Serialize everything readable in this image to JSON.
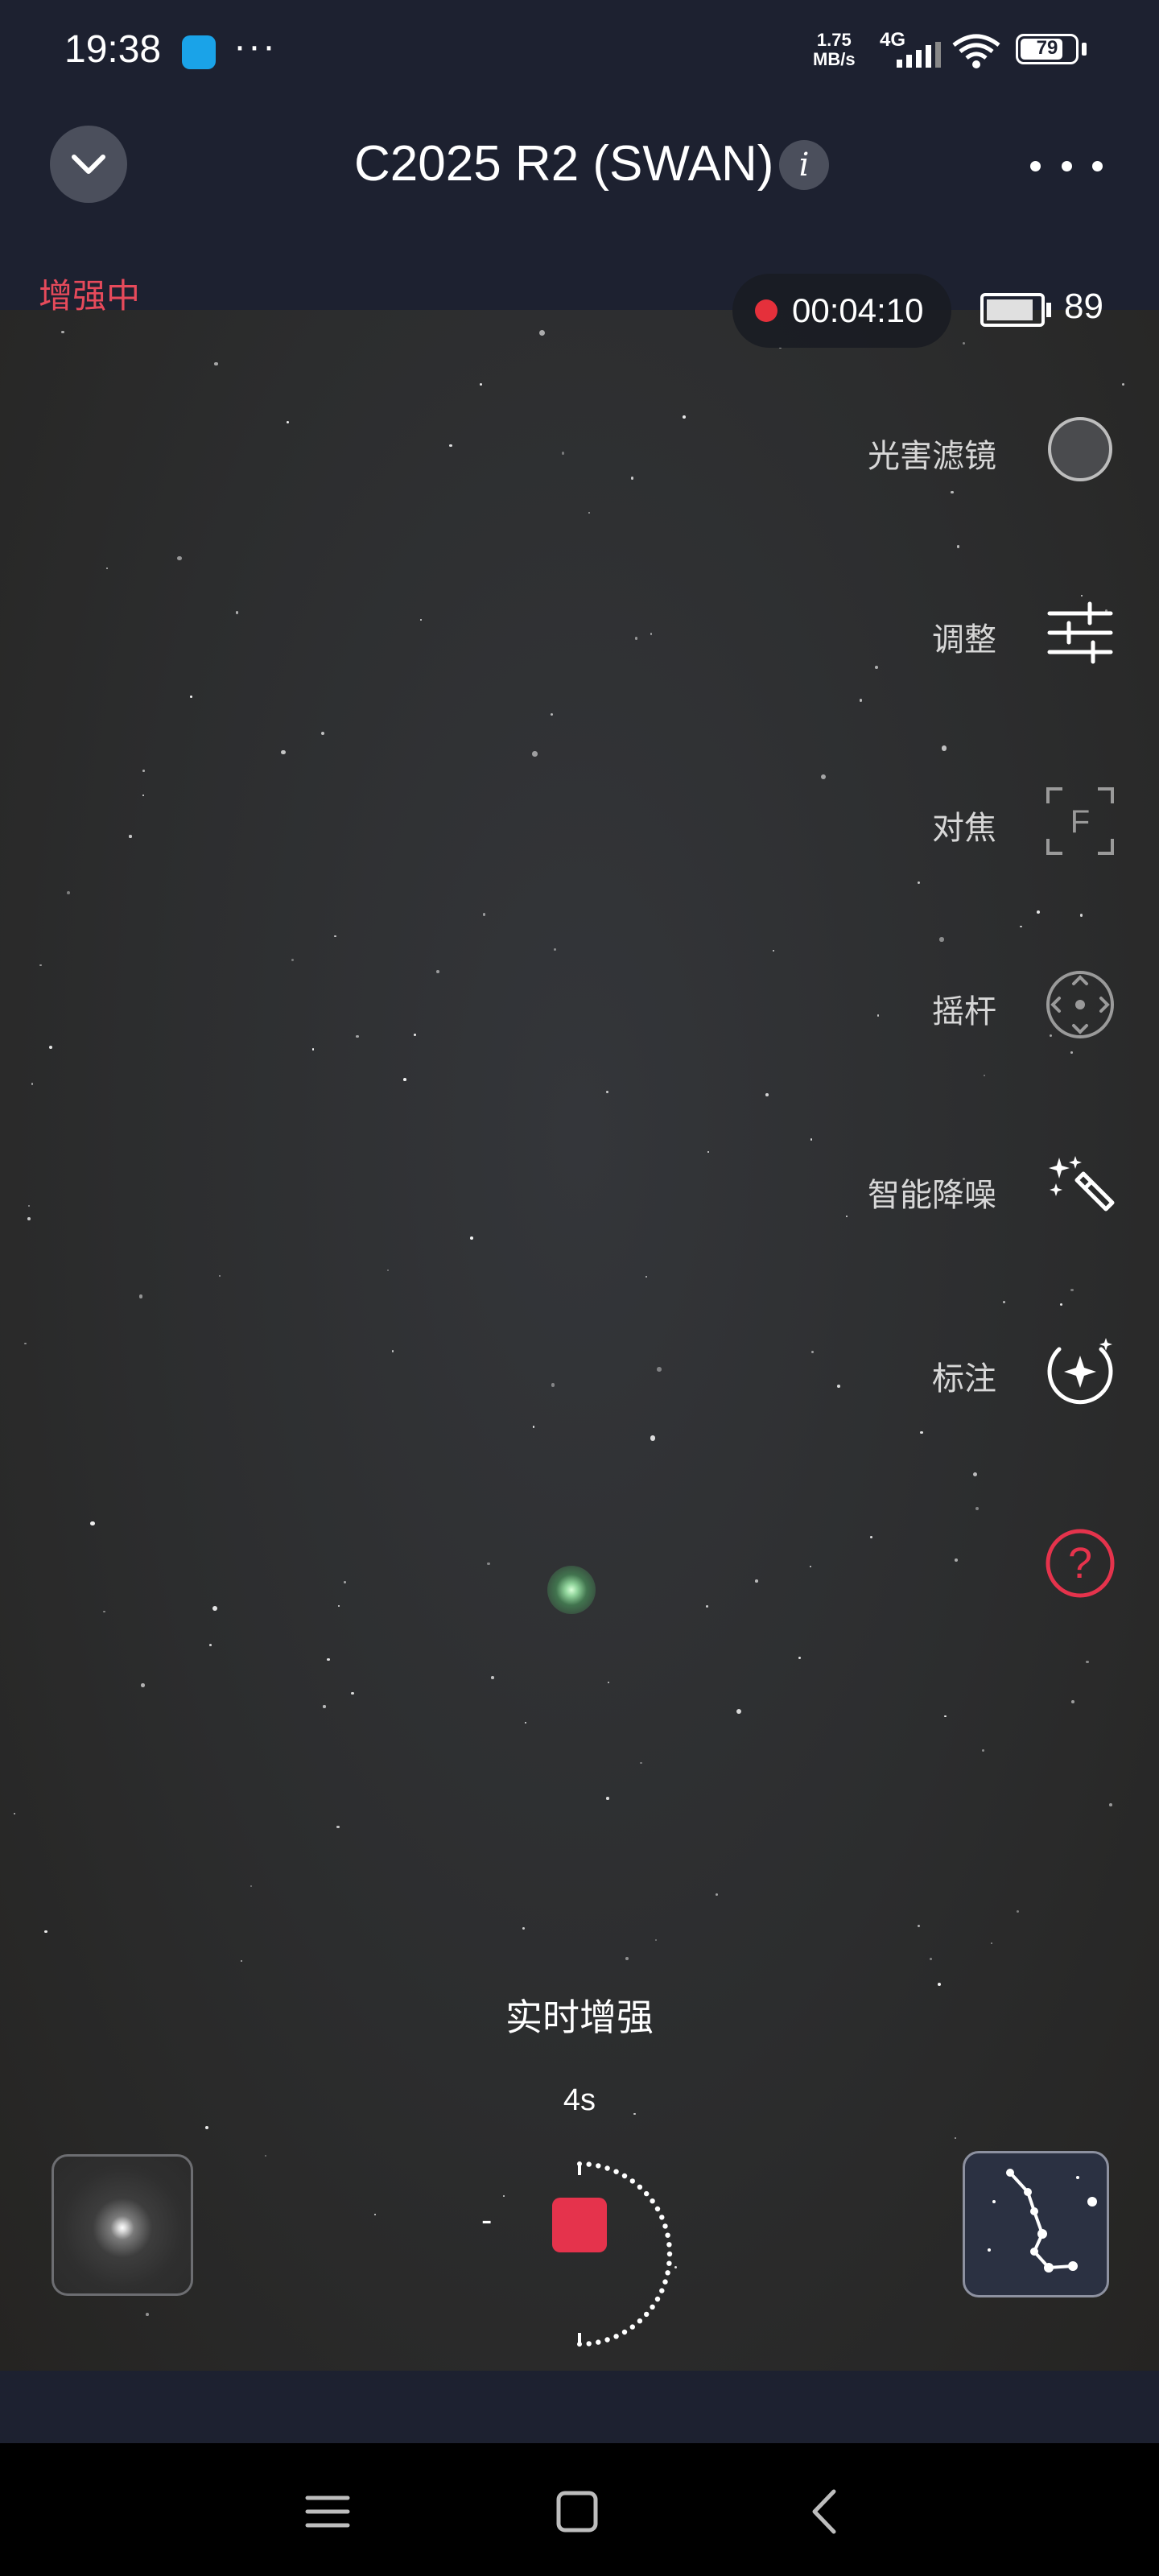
{
  "status_bar": {
    "time": "19:38",
    "more": "···",
    "net_speed_value": "1.75",
    "net_speed_unit": "MB/s",
    "network": "4G",
    "battery": "79"
  },
  "header": {
    "title": "C2025 R2 (SWAN)",
    "info_symbol": "i"
  },
  "session": {
    "status": "增强中",
    "elapsed": "00:04:10",
    "device_battery": "89",
    "device_battery_level": 0.89,
    "phone_battery_level": 0.79
  },
  "tools": [
    {
      "label": "光害滤镜",
      "icon": "filter-circle-icon"
    },
    {
      "label": "调整",
      "icon": "sliders-icon"
    },
    {
      "label": "对焦",
      "icon": "focus-icon"
    },
    {
      "label": "摇杆",
      "icon": "joystick-icon"
    },
    {
      "label": "智能降噪",
      "icon": "magic-wand-icon"
    },
    {
      "label": "标注",
      "icon": "annotate-star-icon"
    },
    {
      "label": "",
      "icon": "help-icon"
    }
  ],
  "capture": {
    "mode_label": "实时增强",
    "exposure": "4s",
    "minus": "-"
  },
  "colors": {
    "background": "#1d2130",
    "accent_red": "#e5334c",
    "status_red": "#e64a5b"
  }
}
